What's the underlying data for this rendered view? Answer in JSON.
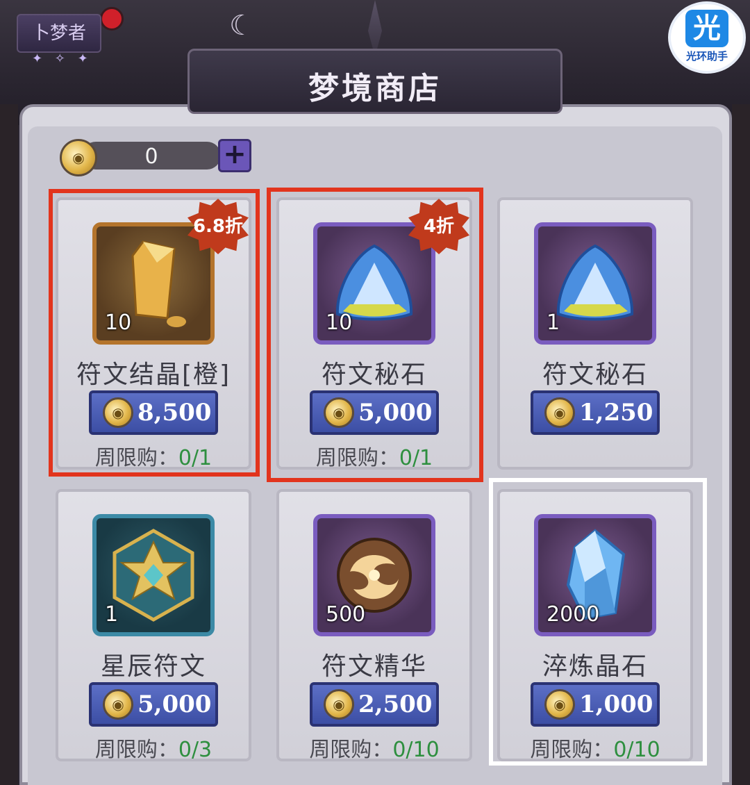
{
  "header": {
    "role_badge": "卜梦者",
    "helper_glyph": "光",
    "helper_label": "光环助手",
    "title": "梦境商店"
  },
  "currency": {
    "amount": "0",
    "plus_label": "+"
  },
  "colors": {
    "price_button": "#4a5cb8",
    "discount_badge": "#c03a1c",
    "highlight_red": "#e2341d",
    "highlight_white": "#ffffff",
    "limit_count": "#2e8f3f"
  },
  "items": [
    {
      "name": "符文结晶[橙]",
      "qty": "10",
      "price": "8,500",
      "limit_label": "周限购：",
      "limit_count": "0/1",
      "discount": "6.8折",
      "icon": "orange-crystal-icon"
    },
    {
      "name": "符文秘石",
      "qty": "10",
      "price": "5,000",
      "limit_label": "周限购：",
      "limit_count": "0/1",
      "discount": "4折",
      "icon": "rune-stone-icon"
    },
    {
      "name": "符文秘石",
      "qty": "1",
      "price": "1,250",
      "limit_label": "周限购：",
      "limit_count": "",
      "discount": "",
      "icon": "rune-stone-icon"
    },
    {
      "name": "星辰符文",
      "qty": "1",
      "price": "5,000",
      "limit_label": "周限购：",
      "limit_count": "0/3",
      "discount": "",
      "icon": "star-rune-icon"
    },
    {
      "name": "符文精华",
      "qty": "500",
      "price": "2,500",
      "limit_label": "周限购：",
      "limit_count": "0/10",
      "discount": "",
      "icon": "rune-essence-icon"
    },
    {
      "name": "淬炼晶石",
      "qty": "2000",
      "price": "1,000",
      "limit_label": "周限购：",
      "limit_count": "0/10",
      "discount": "",
      "icon": "refining-crystal-icon"
    }
  ]
}
